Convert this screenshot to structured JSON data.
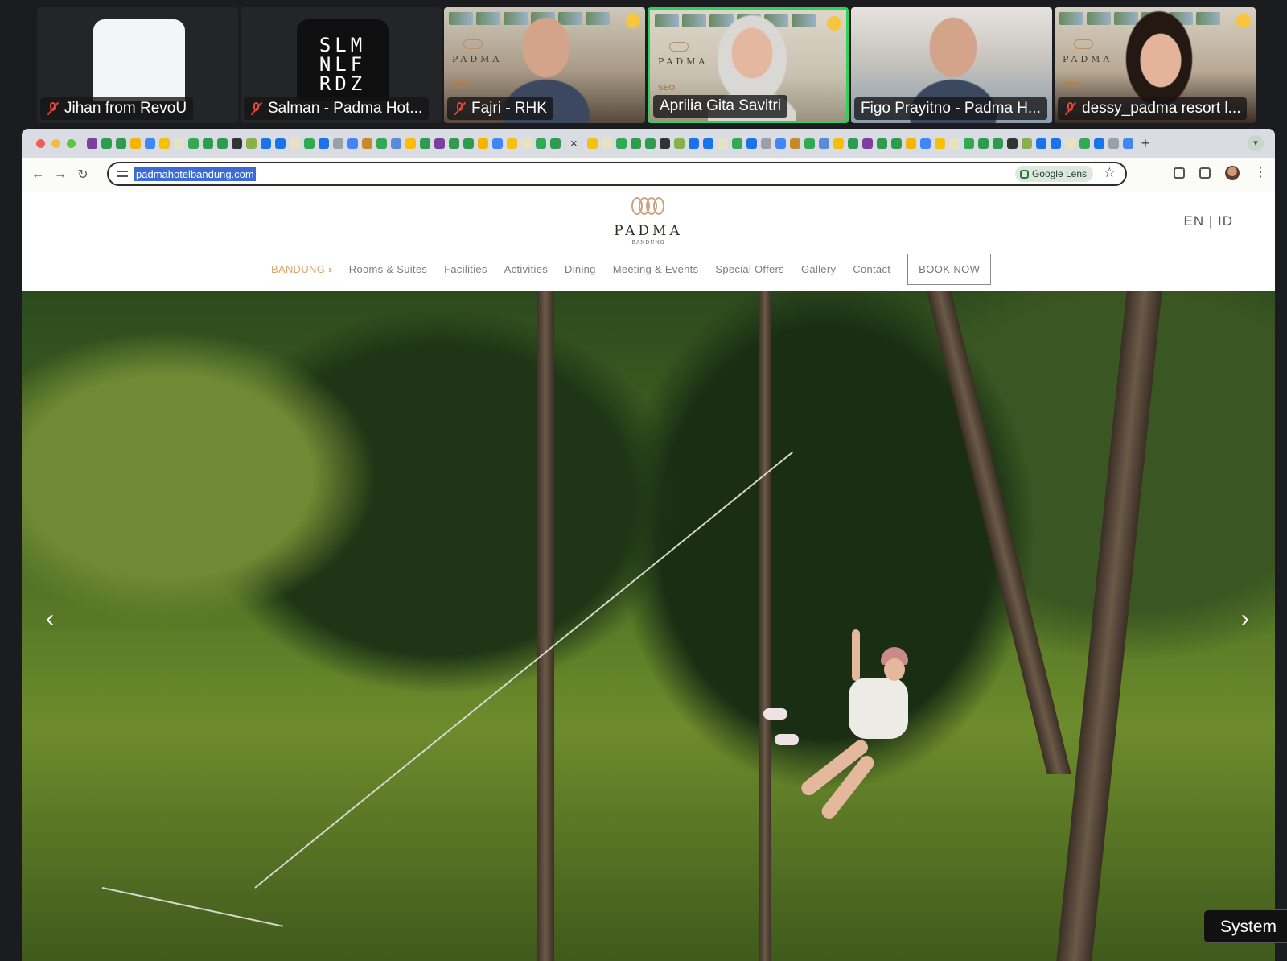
{
  "participants": [
    {
      "name": "Jihan from RevoU",
      "muted": true
    },
    {
      "name": "Salman - Padma Hot...",
      "muted": true,
      "initials": "SLM\nNLF\nRDZ"
    },
    {
      "name": "Fajri - RHK",
      "muted": true
    },
    {
      "name": "Aprilia Gita Savitri",
      "muted": false,
      "speaking": true
    },
    {
      "name": "Figo Prayitno - Padma H...",
      "muted": false
    },
    {
      "name": "dessy_padma resort l...",
      "muted": true
    }
  ],
  "shared_slide": {
    "brand": "PADMA",
    "tag": "SEO"
  },
  "browser": {
    "url": "padmahotelbandung.com",
    "lens_label": "Google Lens",
    "tab_close": "×",
    "new_tab": "+"
  },
  "site": {
    "logo_word": "PADMA",
    "logo_sub": "BANDUNG",
    "lang": "EN  |  ID",
    "nav": {
      "location": "BANDUNG",
      "items": [
        "Rooms & Suites",
        "Facilities",
        "Activities",
        "Dining",
        "Meeting & Events",
        "Special Offers",
        "Gallery",
        "Contact"
      ],
      "book": "BOOK NOW"
    },
    "hero": {
      "prev": "‹",
      "next": "›"
    }
  },
  "system_toast": "System",
  "colors": {
    "speaking_border": "#2fd15b",
    "muted_mic": "#e2453c",
    "nav_active": "#d9a672",
    "url_highlight": "#3b6bd6"
  }
}
